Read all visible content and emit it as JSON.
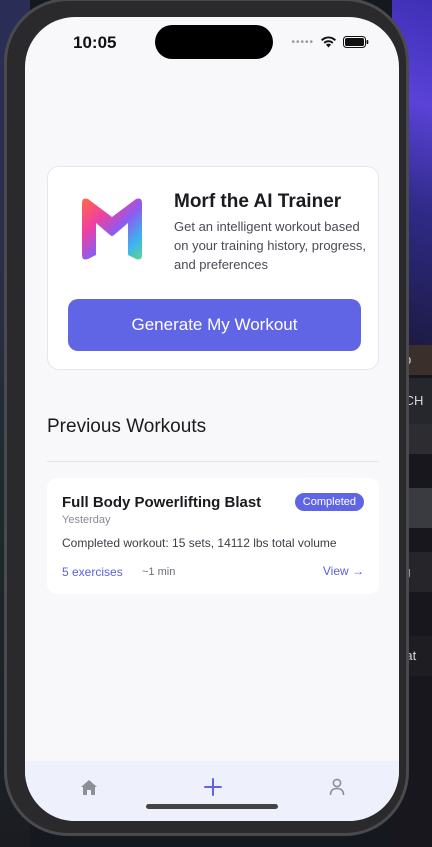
{
  "status_bar": {
    "time": "10:05",
    "carrier_dots": "•••••"
  },
  "morf_card": {
    "title": "Morf the AI Trainer",
    "description": "Get an intelligent workout based on your training history, progress, and preferences",
    "generate_button_label": "Generate My Workout"
  },
  "previous_workouts": {
    "section_title": "Previous Workouts",
    "items": [
      {
        "title": "Full Body Powerlifting Blast",
        "status": "Completed",
        "date": "Yesterday",
        "summary": "Completed workout: 15 sets, 14112 lbs total volume",
        "exercises": "5 exercises",
        "duration": "~1 min",
        "view_label": "View →"
      }
    ]
  },
  "background": {
    "right_text_1": "b",
    "right_text_2": "SCH",
    "right_text_3": "ng",
    "right_text_4": "wat"
  },
  "colors": {
    "accent": "#6065e6",
    "accent_text": "#5a5fe0",
    "screen_bg": "#f8f8fa",
    "tab_bar_bg": "#eef0fc"
  },
  "icons": {
    "tab_home": "home-icon",
    "tab_add": "plus-icon",
    "tab_profile": "person-icon"
  }
}
